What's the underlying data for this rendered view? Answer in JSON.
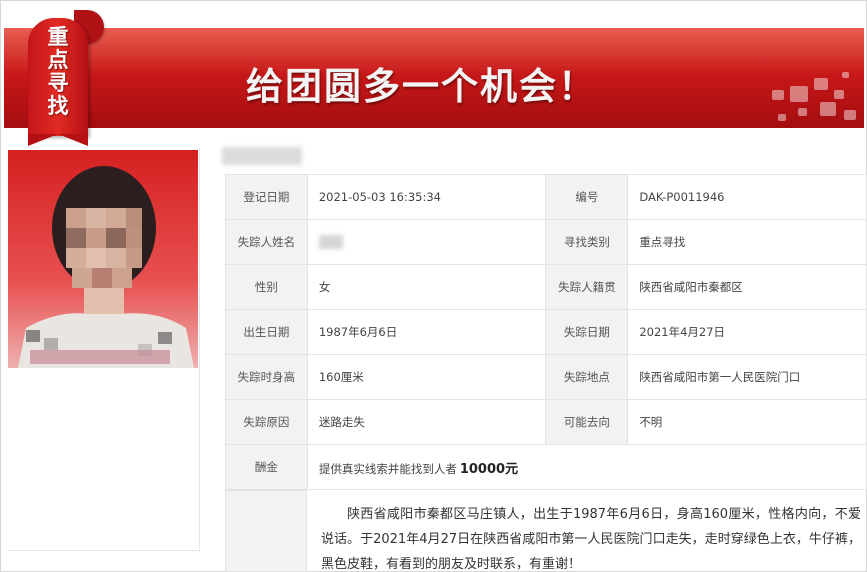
{
  "banner": {
    "tag": [
      "重",
      "点",
      "寻",
      "找"
    ],
    "slogan": "给团圆多一个机会！",
    "brand_color": "#c81818"
  },
  "person": {
    "name_blurred": "██████"
  },
  "info": {
    "rows": [
      {
        "l1": "登记日期",
        "v1": "2021-05-03 16:35:34",
        "l2": "编号",
        "v2": "DAK-P0011946"
      },
      {
        "l1": "失踪人姓名",
        "v1": "",
        "l2": "寻找类别",
        "v2": "重点寻找"
      },
      {
        "l1": "性别",
        "v1": "女",
        "l2": "失踪人籍贯",
        "v2": "陕西省咸阳市秦都区"
      },
      {
        "l1": "出生日期",
        "v1": "1987年6月6日",
        "l2": "失踪日期",
        "v2": "2021年4月27日"
      },
      {
        "l1": "失踪时身高",
        "v1": "160厘米",
        "l2": "失踪地点",
        "v2": "陕西省咸阳市第一人民医院门口"
      },
      {
        "l1": "失踪原因",
        "v1": "迷路走失",
        "l2": "可能去向",
        "v2": "不明"
      }
    ],
    "reward_label": "酬金",
    "reward_text": "提供真实线索并能找到人者",
    "reward_amount": "10000元"
  },
  "description": "陕西省咸阳市秦都区马庄镇人，出生于1987年6月6日，身高160厘米，性格内向，不爱说话。于2021年4月27日在陕西省咸阳市第一人民医院门口走失，走时穿绿色上衣，牛仔裤，黑色皮鞋，有看到的朋友及时联系，有重谢！"
}
